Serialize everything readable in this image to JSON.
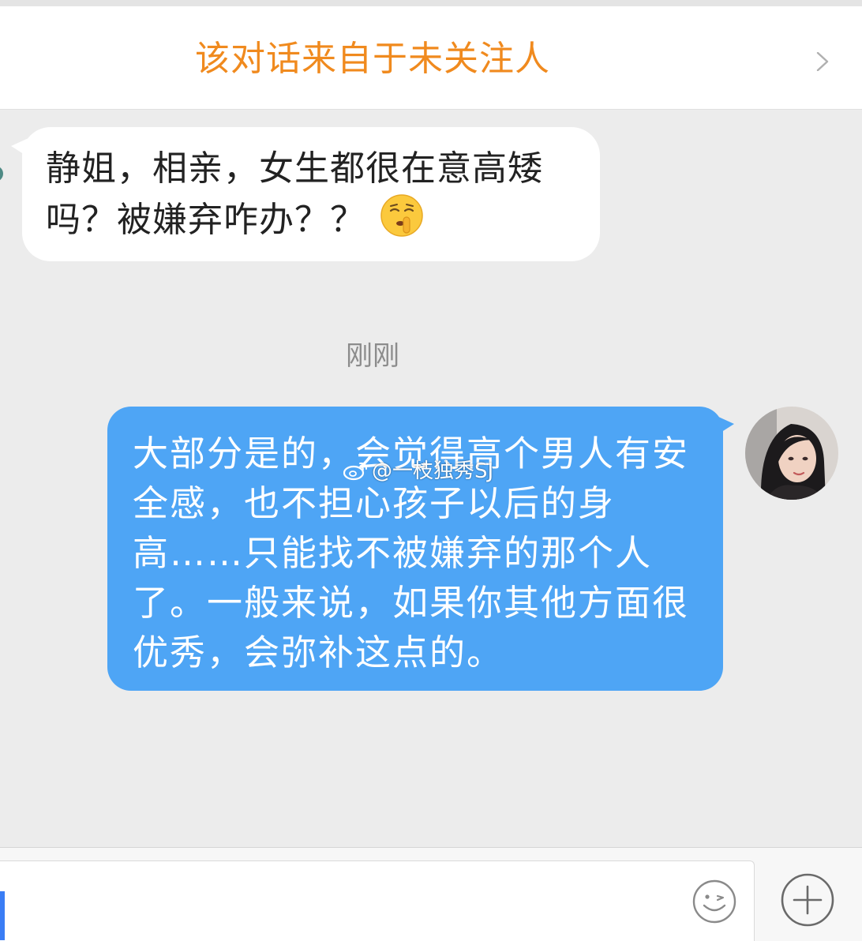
{
  "banner": {
    "text": "该对话来自于未关注人",
    "chevron_icon": "chevron-right-icon"
  },
  "messages": {
    "incoming": {
      "line1": "静姐，相亲，女生都很在意高矮",
      "line2": "吗？被嫌弃咋办？？",
      "emoji": "shushing-face-emoji"
    },
    "timestamp": "刚刚",
    "outgoing": {
      "lines": [
        "大部分是的，会觉得高个男人有安",
        "全感，也不担心孩子以后的身",
        "高……只能找不被嫌弃的那个人",
        "了。一般来说，如果你其他方面很",
        "优秀，会弥补这点的。"
      ]
    }
  },
  "watermark": {
    "text": "@一枝独秀SJ",
    "icon": "weibo-logo-icon"
  },
  "input_bar": {
    "emoji_icon": "emoji-smile-icon",
    "plus_icon": "plus-circle-icon"
  },
  "colors": {
    "banner_text": "#f08a1e",
    "outgoing_bubble": "#4ea5f5",
    "chat_background": "#ececec",
    "cursor": "#3a7df5"
  }
}
